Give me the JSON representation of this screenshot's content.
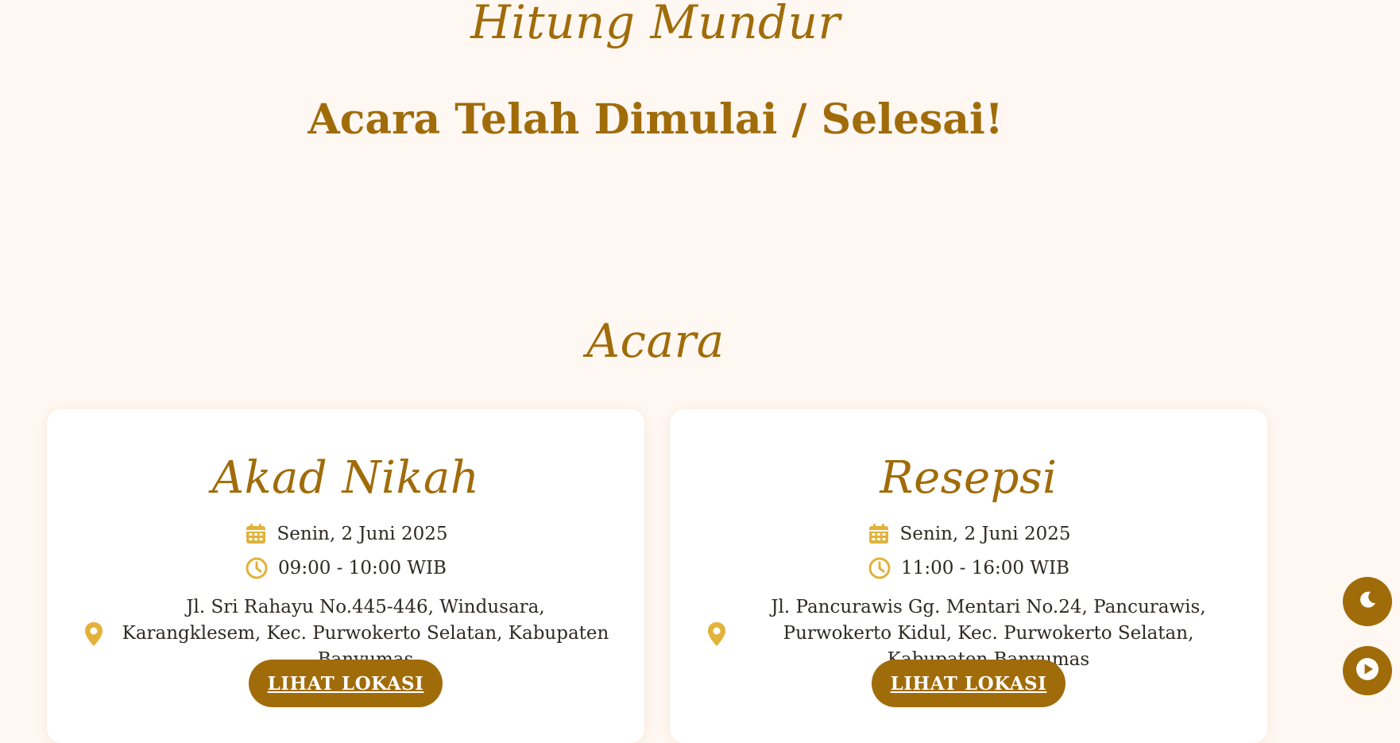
{
  "countdown": {
    "title": "Hitung Mundur",
    "message": "Acara Telah Dimulai / Selesai!"
  },
  "events": {
    "title": "Acara",
    "cards": [
      {
        "title": "Akad Nikah",
        "date": "Senin, 2 Juni 2025",
        "time": "09:00 - 10:00 WIB",
        "address": "Jl. Sri Rahayu No.445-446, Windusara, Karangklesem, Kec. Purwokerto Selatan, Kabupaten Banyumas",
        "button_label": "LIHAT LOKASI"
      },
      {
        "title": "Resepsi",
        "date": "Senin, 2 Juni 2025",
        "time": "11:00 - 16:00 WIB",
        "address": "Jl. Pancurawis Gg. Mentari No.24, Pancurawis, Purwokerto Kidul, Kec. Purwokerto Selatan, Kabupaten Banyumas",
        "button_label": "LIHAT LOKASI"
      }
    ]
  },
  "floating": {
    "theme_icon": "moon-icon",
    "music_icon": "play-icon"
  },
  "colors": {
    "background": "#fff7f1",
    "accent": "#a06c0a",
    "icon": "#e2b23a",
    "card": "#ffffff",
    "text": "#2e2a24"
  }
}
